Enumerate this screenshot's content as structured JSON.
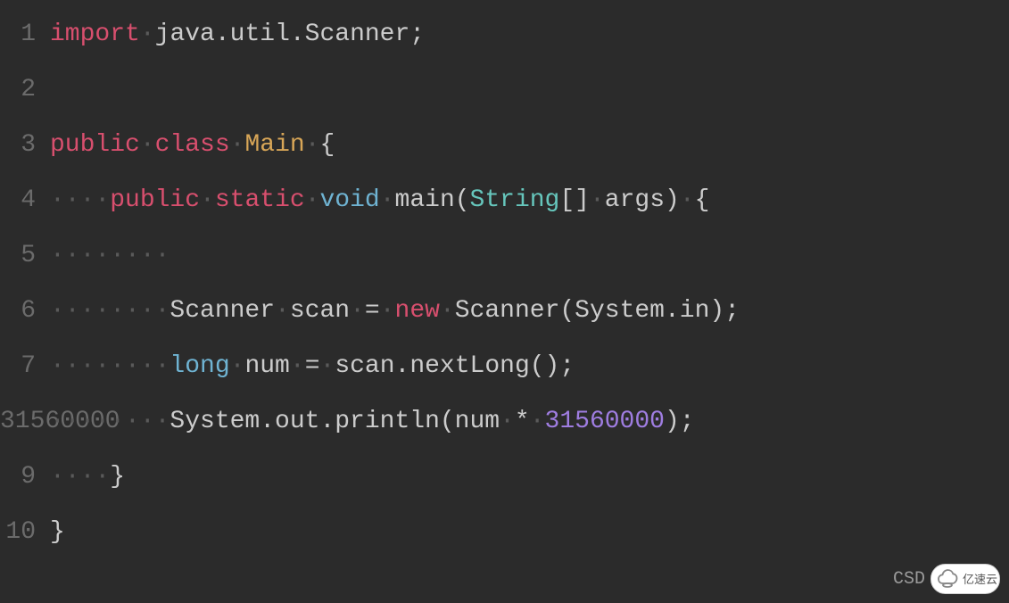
{
  "lines": {
    "l1": {
      "num": "1",
      "import": "import",
      "ws1": " ",
      "rest": "java.util.Scanner;"
    },
    "l2": {
      "num": "2"
    },
    "l3": {
      "num": "3",
      "public": "public",
      "ws1": " ",
      "class": "class",
      "ws2": " ",
      "main": "Main",
      "ws3": " ",
      "brace": "{"
    },
    "l4": {
      "num": "4",
      "ws1": "    ",
      "public": "public",
      "ws2": " ",
      "static": "static",
      "ws3": " ",
      "void": "void",
      "ws4": " ",
      "fn": "main(",
      "type": "String",
      "br": "[]",
      "ws5": " ",
      "args": "args)",
      "ws6": " ",
      "brace": "{"
    },
    "l5": {
      "num": "5",
      "ws1": "        "
    },
    "l6": {
      "num": "6",
      "ws1": "        ",
      "t1": "Scanner",
      "ws2": " ",
      "t2": "scan",
      "ws3": " ",
      "eq": "=",
      "ws4": " ",
      "new": "new",
      "ws5": " ",
      "t3": "Scanner(System.in);"
    },
    "l7": {
      "num": "7",
      "ws1": "        ",
      "long": "long",
      "ws2": " ",
      "t1": "num",
      "ws3": " ",
      "eq": "=",
      "ws4": " ",
      "t2": "scan.nextLong();"
    },
    "l8": {
      "num": "31560000",
      "ws1": "        ",
      "t1": "System.out.println(num",
      "ws2": " ",
      "star": "*",
      "ws3": " ",
      "t2": ");"
    },
    "l9": {
      "num": "9",
      "ws1": "    ",
      "brace": "}"
    },
    "l10": {
      "num": "10",
      "brace": "}"
    }
  },
  "watermark": {
    "csdn": "CSD",
    "cloud": "亿速云"
  },
  "colors": {
    "bg": "#2b2b2b",
    "text": "#cccccc",
    "keyword_red": "#d84f6e",
    "keyword_blue": "#6fb3d2",
    "type_teal": "#66c6bc",
    "class_gold": "#d8a657",
    "number_purple": "#9f7de1",
    "whitespace_dot": "#5a5a5a",
    "gutter": "#6b6b6b"
  }
}
